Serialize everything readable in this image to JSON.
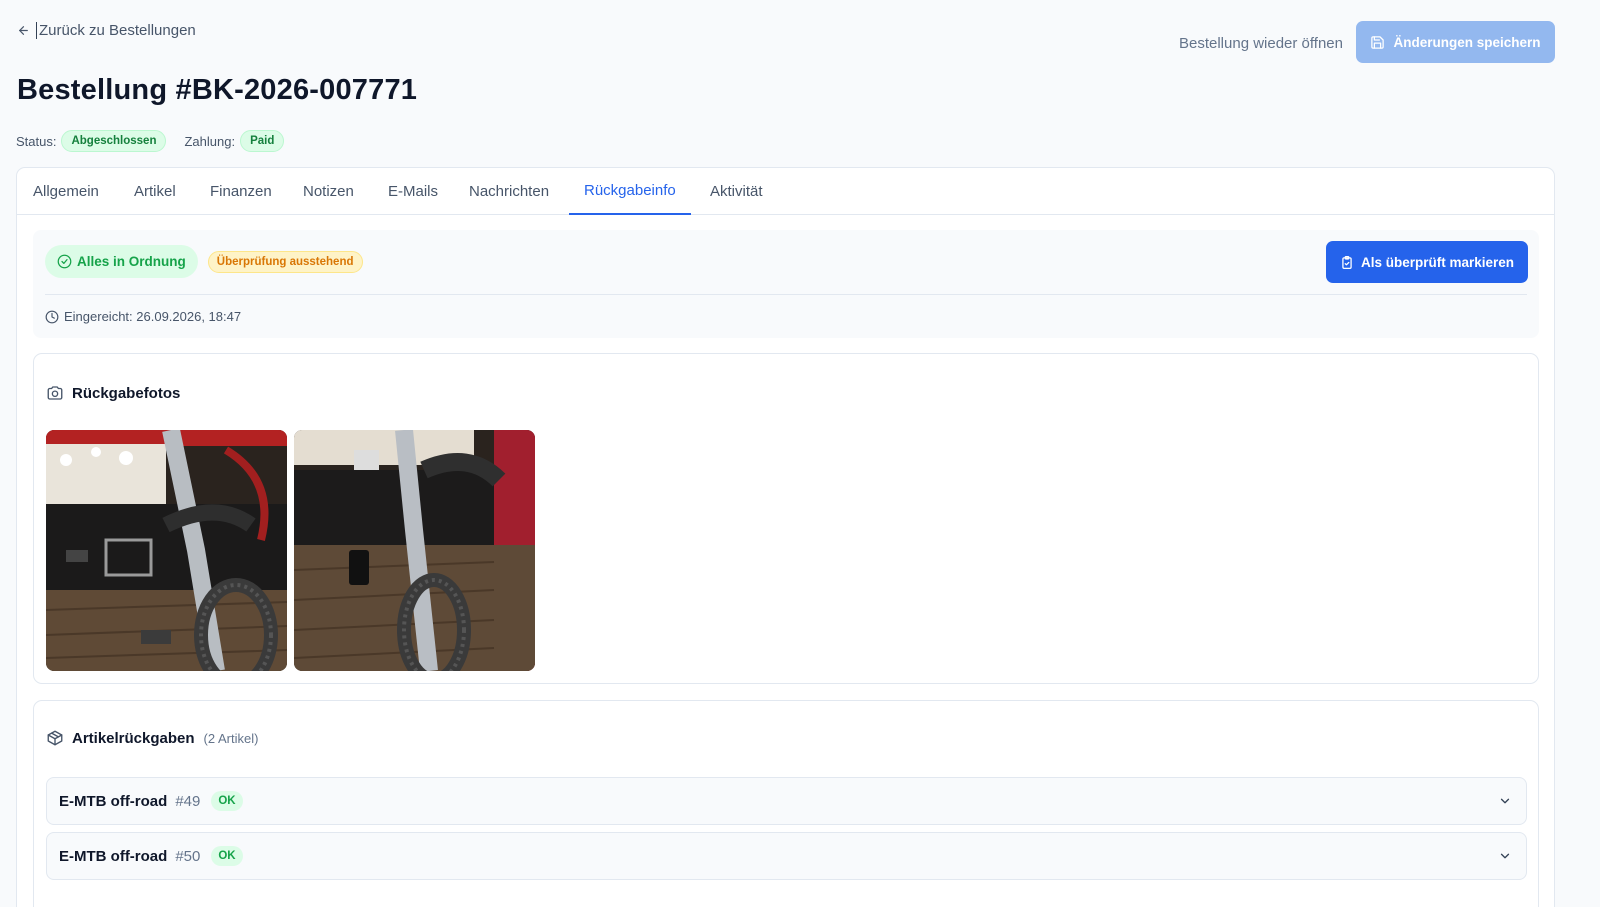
{
  "header": {
    "back_label": "Zurück zu Bestellungen",
    "title": "Bestellung #BK-2026-007771",
    "status_label": "Status:",
    "status_value": "Abgeschlossen",
    "payment_label": "Zahlung:",
    "payment_value": "Paid",
    "reopen_label": "Bestellung wieder öffnen",
    "save_label": "Änderungen speichern"
  },
  "tabs": [
    {
      "label": "Allgemein",
      "active": false
    },
    {
      "label": "Artikel",
      "active": false
    },
    {
      "label": "Finanzen",
      "active": false
    },
    {
      "label": "Notizen",
      "active": false
    },
    {
      "label": "E-Mails",
      "active": false
    },
    {
      "label": "Nachrichten",
      "active": false
    },
    {
      "label": "Rückgabeinfo",
      "active": true
    },
    {
      "label": "Aktivität",
      "active": false
    }
  ],
  "review": {
    "ok_label": "Alles in Ordnung",
    "pending_label": "Überprüfung ausstehend",
    "mark_label": "Als überprüft markieren",
    "submitted": "Eingereicht: 26.09.2026, 18:47"
  },
  "photos": {
    "title": "Rückgabefotos",
    "count": 2
  },
  "items": {
    "title": "Artikelrückgaben",
    "count_label": "(2 Artikel)",
    "rows": [
      {
        "name": "E-MTB off-road",
        "number": "#49",
        "status": "OK"
      },
      {
        "name": "E-MTB off-road",
        "number": "#50",
        "status": "OK"
      }
    ]
  },
  "colors": {
    "primary": "#2563eb",
    "primary_disabled": "#93b8ef",
    "success": "#16a34a",
    "warning": "#d97706"
  }
}
